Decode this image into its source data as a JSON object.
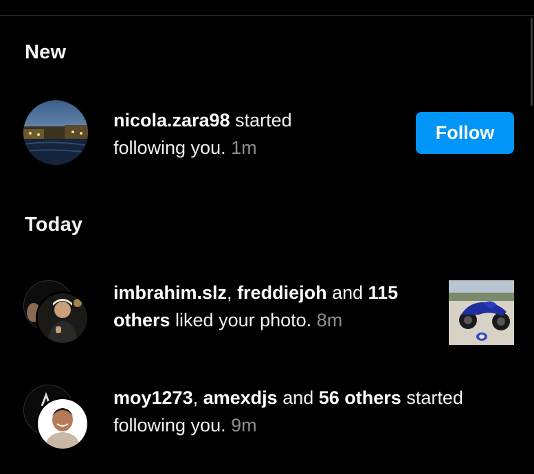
{
  "sections": {
    "new": {
      "title": "New",
      "items": [
        {
          "user": "nicola.zara98",
          "action": " started",
          "line2": "following you.",
          "time": "1m",
          "button": "Follow",
          "avatar_icon": "city-canal-photo"
        }
      ]
    },
    "today": {
      "title": "Today",
      "items": [
        {
          "user1": "imbrahim.slz",
          "sep1": ", ",
          "user2": "freddiejoh",
          "and": " and ",
          "count": "115",
          "others": "others",
          "action": " liked your photo.",
          "time": "8m",
          "avatar_icon": "person-night-photo",
          "thumb_icon": "blue-motorcycle-photo"
        },
        {
          "user1": "moy1273",
          "sep1": ", ",
          "user2": "amexdjs",
          "and": " and ",
          "others_bold": "56 others",
          "action": " started",
          "line2": "following you.",
          "time": "9m",
          "avatar_icon": "smiling-man-photo"
        }
      ]
    }
  },
  "colors": {
    "background": "#000000",
    "accent": "#0095f6",
    "muted": "#8e8e8e"
  }
}
